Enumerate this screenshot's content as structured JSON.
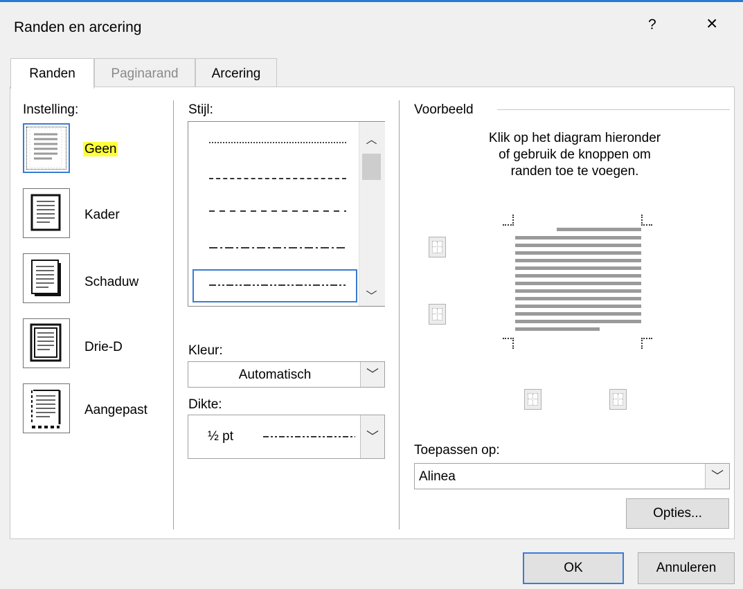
{
  "window": {
    "title": "Randen en arcering",
    "help": "?",
    "close": "×"
  },
  "tabs": [
    {
      "label": "Randen",
      "mnemonic_index": 2
    },
    {
      "label": "Paginarand"
    },
    {
      "label": "Arcering"
    }
  ],
  "settings": {
    "label": "Instelling:",
    "items": [
      {
        "label": "Geen",
        "icon": "setting-none-icon",
        "selected": true,
        "highlight": "#ffff3a"
      },
      {
        "label": "Kader",
        "icon": "setting-box-icon"
      },
      {
        "label": "Schaduw",
        "icon": "setting-shadow-icon"
      },
      {
        "label": "Drie-D",
        "icon": "setting-3d-icon"
      },
      {
        "label": "Aangepast",
        "icon": "setting-custom-icon"
      }
    ]
  },
  "style": {
    "label": "Stijl:",
    "options": [
      "dotted-fine",
      "dashed-short",
      "dashed-medium",
      "dash-dot",
      "dash-dot-dot"
    ],
    "selected": "dash-dot-dot"
  },
  "color": {
    "label": "Kleur:",
    "value": "Automatisch"
  },
  "width": {
    "label": "Dikte:",
    "value": "½ pt"
  },
  "preview": {
    "label": "Voorbeeld",
    "instructions": [
      "Klik op het diagram hieronder",
      "of gebruik de knoppen om",
      "randen toe te voegen."
    ]
  },
  "apply_to": {
    "label": "Toepassen op:",
    "value": "Alinea"
  },
  "buttons": {
    "options": "Opties...",
    "ok": "OK",
    "cancel": "Annuleren"
  },
  "colors": {
    "accent": "#3a7bd5",
    "title_bar_line": "#2b79d0"
  }
}
